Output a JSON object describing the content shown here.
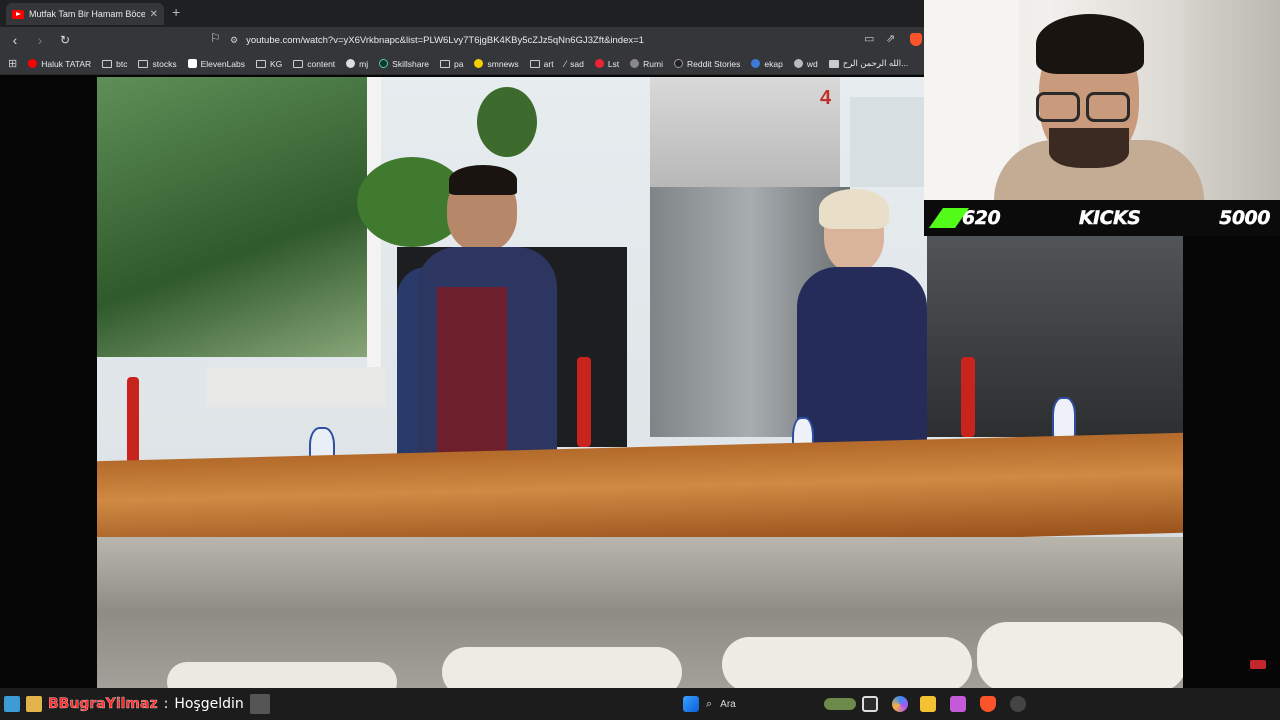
{
  "browser": {
    "tab_title": "Mutfak Tam Bir Hamam Böcek",
    "new_tab_symbol": "+",
    "url": "youtube.com/watch?v=yX6Vrkbnapc&list=PLW6Lvy7T6jgBK4KBy5cZJz5qNn6GJ3Zft&index=1",
    "bookmarks": [
      {
        "label": "Haluk TATAR",
        "icon": "youtube-icon"
      },
      {
        "label": "btc",
        "icon": "folder-icon"
      },
      {
        "label": "stocks",
        "icon": "folder-icon"
      },
      {
        "label": "ElevenLabs",
        "icon": "elevenlabs-icon"
      },
      {
        "label": "KG",
        "icon": "folder-icon"
      },
      {
        "label": "content",
        "icon": "folder-icon"
      },
      {
        "label": "mj",
        "icon": "github-icon"
      },
      {
        "label": "Skillshare",
        "icon": "skillshare-icon"
      },
      {
        "label": "pa",
        "icon": "folder-icon"
      },
      {
        "label": "smnews",
        "icon": "smiley-icon"
      },
      {
        "label": "art",
        "icon": "folder-icon"
      },
      {
        "label": "sad",
        "icon": "x-icon"
      },
      {
        "label": "Lst",
        "icon": "s-icon"
      },
      {
        "label": "Rumi",
        "icon": "globe-icon"
      },
      {
        "label": "Reddit Stories",
        "icon": "d-icon"
      },
      {
        "label": "ekap",
        "icon": "bird-icon"
      },
      {
        "label": "wd",
        "icon": "globe-icon"
      },
      {
        "label": "الله الرحمن الرح...",
        "icon": "doc-icon"
      }
    ]
  },
  "overlay": {
    "score_left": "620",
    "score_label": "KICKS",
    "score_right": "5000",
    "accent_color": "#53fc18"
  },
  "chat": {
    "username": "BBugraYilmaz",
    "separator": ":",
    "message": "Hoşgeldin"
  },
  "taskbar": {
    "search_placeholder": "Ara"
  },
  "video": {
    "corner_mark": "4"
  }
}
